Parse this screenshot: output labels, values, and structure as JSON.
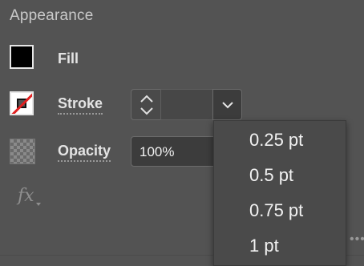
{
  "panel": {
    "title": "Appearance",
    "fill": {
      "label": "Fill",
      "color": "#000000"
    },
    "stroke": {
      "label": "Stroke",
      "value": "",
      "none_indicator_color": "#e02020"
    },
    "opacity": {
      "label": "Opacity",
      "value": "100%"
    },
    "fx_label": "fx",
    "more_label": "•••"
  },
  "dropdown": {
    "options": [
      "0.25 pt",
      "0.5 pt",
      "0.75 pt",
      "1 pt"
    ]
  },
  "icons": {
    "stepper": "up-down-stepper-icon",
    "chevron": "chevron-down-icon",
    "checker": "transparency-checker-icon",
    "fx": "fx-effects-icon"
  }
}
